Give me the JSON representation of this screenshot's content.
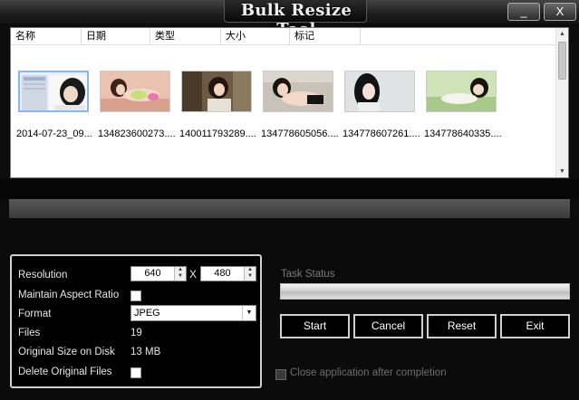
{
  "window": {
    "title": "Bulk Resize Tool",
    "minimize_glyph": "_",
    "close_glyph": "X"
  },
  "file_list": {
    "columns": [
      "名称",
      "日期",
      "类型",
      "大小",
      "标记"
    ],
    "items": [
      {
        "name": "2014-07-23_09...",
        "selected": true
      },
      {
        "name": "134823600273....",
        "selected": false
      },
      {
        "name": "140011793289....",
        "selected": false
      },
      {
        "name": "134778605056....",
        "selected": false
      },
      {
        "name": "134778607261....",
        "selected": false
      },
      {
        "name": "134778640335....",
        "selected": false
      }
    ]
  },
  "settings": {
    "resolution_label": "Resolution",
    "width_value": "640",
    "x_separator": "X",
    "height_value": "480",
    "aspect_label": "Maintain Aspect Ratio",
    "aspect_checked": false,
    "format_label": "Format",
    "format_value": "JPEG",
    "files_label": "Files",
    "files_value": "19",
    "size_label": "Original Size on Disk",
    "size_value": "13 MB",
    "delete_label": "Delete Original Files",
    "delete_checked": false
  },
  "task": {
    "status_label": "Task Status",
    "progress_fraction": 0,
    "buttons": {
      "start": "Start",
      "cancel": "Cancel",
      "reset": "Reset",
      "exit": "Exit"
    },
    "close_after_label": "Close application after completion",
    "close_after_checked": false
  },
  "icons": {
    "spin_up": "up-arrow-icon",
    "spin_down": "down-arrow-icon",
    "dropdown": "chevron-down-icon"
  }
}
